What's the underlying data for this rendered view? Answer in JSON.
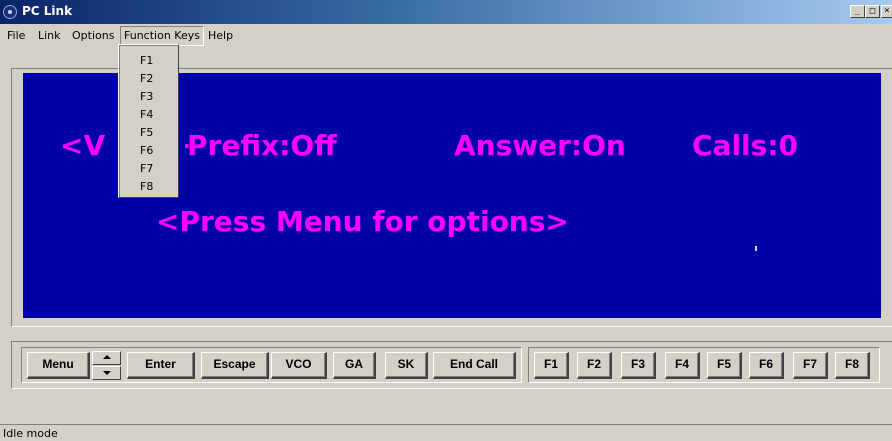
{
  "window": {
    "title": "PC Link",
    "minimize_label": "_",
    "maximize_label": "□",
    "close_label": "×"
  },
  "menubar": {
    "items": [
      "File",
      "Link",
      "Options",
      "Function Keys",
      "Help"
    ],
    "open_menu": "Function Keys"
  },
  "function_keys_menu": {
    "items": [
      "F1",
      "F2",
      "F3",
      "F4",
      "F5",
      "F6",
      "F7",
      "F8"
    ]
  },
  "display": {
    "background_color": "#0000a8",
    "text_color": "#ff00ff",
    "line1_left": "<V",
    "line1_prefix": "Prefix:Off",
    "line1_answer": "Answer:On",
    "line1_calls": "Calls:0",
    "line2": "<Press Menu for options>"
  },
  "buttons": {
    "menu": "Menu",
    "enter": "Enter",
    "escape": "Escape",
    "vco": "VCO",
    "ga": "GA",
    "sk": "SK",
    "end_call": "End Call",
    "function_keys": [
      "F1",
      "F2",
      "F3",
      "F4",
      "F5",
      "F6",
      "F7",
      "F8"
    ]
  },
  "status": {
    "text": "Idle mode"
  }
}
